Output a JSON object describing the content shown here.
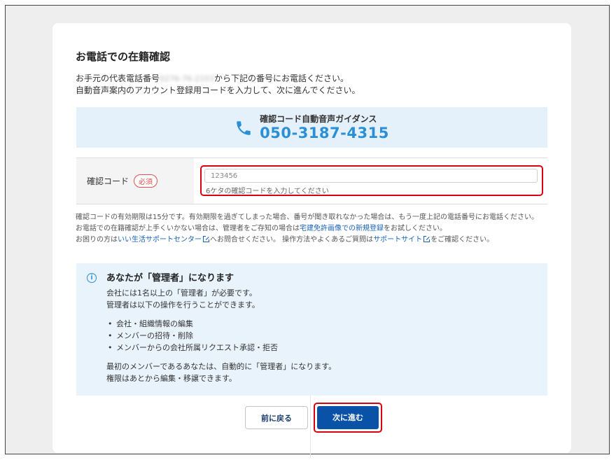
{
  "page": {
    "title": "お電話での在籍確認",
    "intro_line1_prefix": "お手元の代表電話番号",
    "intro_phone_blurred": "0276-76-2103",
    "intro_line1_suffix": "から下記の番号にお電話ください。",
    "intro_line2": "自動音声案内のアカウント登録用コードを入力して、次に進んでください。"
  },
  "guidance": {
    "label": "確認コード自動音声ガイダンス",
    "number": "050-3187-4315",
    "icon": "phone-icon"
  },
  "form": {
    "code_label": "確認コード",
    "required_badge": "必須",
    "code_value": "123456",
    "code_hint": "6ケタの確認コードを入力してください"
  },
  "notes": {
    "line1": "確認コードの有効期限は15分です。有効期限を過ぎてしまった場合、番号が聞き取れなかった場合は、もう一度上記の電話番号にお電話ください。",
    "line2_prefix": "お電話での在籍確認が上手くいかない場合は、管理者をご存知の場合は",
    "line2_link": "宅建免許画像での新規登録",
    "line2_suffix": "をお試しください。",
    "line3_prefix": "お困りの方は",
    "line3_link1": "いい生活サポートセンター",
    "line3_mid": "へお問合せください。 操作方法やよくあるご質問は",
    "line3_link2": "サポートサイト",
    "line3_suffix": "をご確認ください。"
  },
  "admin_info": {
    "title": "あなたが「管理者」になります",
    "line1": "会社には1名以上の「管理者」が必要です。",
    "line2": "管理者は以下の操作を行うことができます。",
    "items": [
      "会社・組織情報の編集",
      "メンバーの招待・削除",
      "メンバーからの会社所属リクエスト承認・拒否"
    ],
    "line3": "最初のメンバーであるあなたは、自動的に「管理者」になります。",
    "line4": "権限はあとから編集・移譲できます。"
  },
  "buttons": {
    "back_label": "前に戻る",
    "next_label": "次に進む"
  },
  "colors": {
    "accent_blue": "#2a8fd6",
    "primary_button": "#0a52a8",
    "highlight_red": "#d9000f",
    "link": "#1a62b8"
  }
}
